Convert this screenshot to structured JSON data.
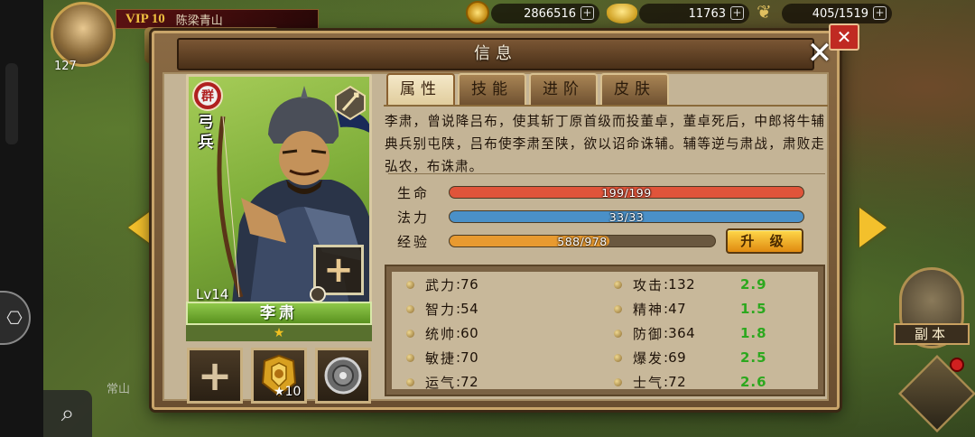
{
  "hud": {
    "avatar_level": "127",
    "vip_label": "VIP 10",
    "player_name": "陈梁青山",
    "gold": "2866516",
    "ingots": "11763",
    "grain": "405/1519",
    "dungeon_label": "副本",
    "map_place": "常山"
  },
  "modal": {
    "title": "信息",
    "tabs": [
      "属性",
      "技能",
      "进阶",
      "皮肤"
    ],
    "active_tab": "属性",
    "description": "李肃，曾说降吕布，使其斩丁原首级而投董卓，董卓死后，中郎将牛辅典兵别屯陕，吕布使李肃至陕，欲以诏命诛辅。辅等逆与肃战，肃败走弘农，布诛肃。",
    "upgrade_label": "升 级"
  },
  "hero": {
    "name": "李肃",
    "faction": "群",
    "unit_type": "弓兵",
    "level": "Lv14",
    "stars": "★",
    "equip_plus": "+",
    "slot_item_count": "10"
  },
  "bars": {
    "hp_label": "生命",
    "hp_text": "199/199",
    "hp_fraction": 1.0,
    "mp_label": "法力",
    "mp_text": "33/33",
    "mp_fraction": 1.0,
    "exp_label": "经验",
    "exp_text": "588/978",
    "exp_fraction": 0.601
  },
  "stats": {
    "left": [
      {
        "name": "武力",
        "value": "76"
      },
      {
        "name": "智力",
        "value": "54"
      },
      {
        "name": "统帅",
        "value": "60"
      },
      {
        "name": "敏捷",
        "value": "70"
      },
      {
        "name": "运气",
        "value": "72"
      }
    ],
    "right": [
      {
        "name": "攻击",
        "value": "132",
        "growth": "2.9"
      },
      {
        "name": "精神",
        "value": "47",
        "growth": "1.5"
      },
      {
        "name": "防御",
        "value": "364",
        "growth": "1.8"
      },
      {
        "name": "爆发",
        "value": "69",
        "growth": "2.5"
      },
      {
        "name": "士气",
        "value": "72",
        "growth": "2.6"
      }
    ]
  },
  "colors": {
    "hp": "#e0543a",
    "mp": "#4a90c8",
    "exp": "#e89a30",
    "growth": "#2ca81e",
    "faction_red": "#b02020"
  }
}
